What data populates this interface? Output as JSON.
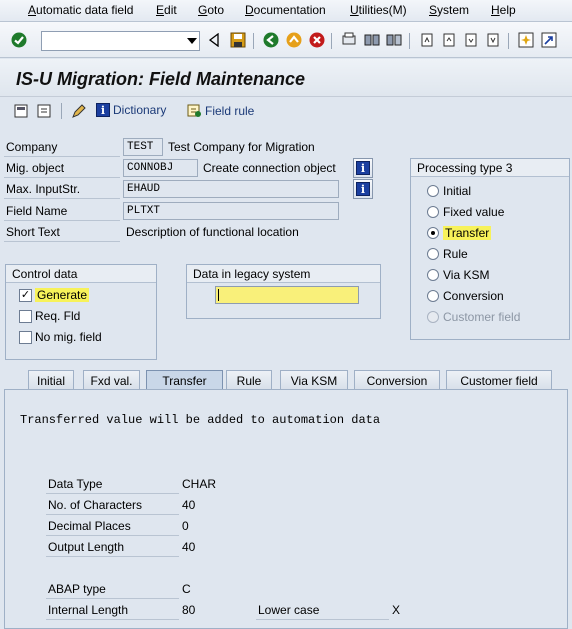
{
  "menu": [
    "Automatic data field",
    "Edit",
    "Goto",
    "Documentation",
    "Utilities(M)",
    "System",
    "Help"
  ],
  "menu_accel": [
    "A",
    "E",
    "G",
    "D",
    "U",
    "S",
    "H"
  ],
  "icons": {
    "enter": "checkmark-icon",
    "save": "save-icon",
    "back": "back-icon",
    "exit": "exit-icon",
    "cancel": "cancel-icon"
  },
  "title": "IS-U Migration: Field Maintenance",
  "app_toolbar": {
    "dictionary": "Dictionary",
    "field_rule": "Field rule"
  },
  "fields": {
    "company_label": "Company",
    "company_value": "TEST",
    "company_desc": "Test Company for Migration",
    "migobj_label": "Mig. object",
    "migobj_value": "CONNOBJ",
    "migobj_desc": "Create connection object",
    "maxinput_label": "Max. InputStr.",
    "maxinput_value": "EHAUD",
    "fieldname_label": "Field Name",
    "fieldname_value": "PLTXT",
    "shorttext_label": "Short Text",
    "shorttext_value": "Description of functional location"
  },
  "processing": {
    "title": "Processing type 3",
    "options": [
      "Initial",
      "Fixed value",
      "Transfer",
      "Rule",
      "Via KSM",
      "Conversion",
      "Customer field"
    ],
    "selected": "Transfer"
  },
  "control": {
    "title": "Control data",
    "generate": "Generate",
    "generate_checked": true,
    "req_fld": "Req. Fld",
    "req_checked": false,
    "no_mig": "No mig. field",
    "no_mig_checked": false
  },
  "legacy": {
    "title": "Data in legacy system",
    "value": ""
  },
  "tabs": [
    "Initial",
    "Fxd val.",
    "Transfer",
    "Rule",
    "Via KSM",
    "Conversion",
    "Customer field"
  ],
  "active_tab": "Transfer",
  "panel": {
    "message": "Transferred value will be added to automation data",
    "data_type_label": "Data Type",
    "data_type_value": "CHAR",
    "chars_label": "No. of Characters",
    "chars_value": "40",
    "decimals_label": "Decimal Places",
    "decimals_value": "0",
    "outlen_label": "Output Length",
    "outlen_value": "40",
    "abap_label": "ABAP type",
    "abap_value": "C",
    "intlen_label": "Internal Length",
    "intlen_value": "80",
    "lower_label": "Lower case",
    "lower_value": "X"
  }
}
